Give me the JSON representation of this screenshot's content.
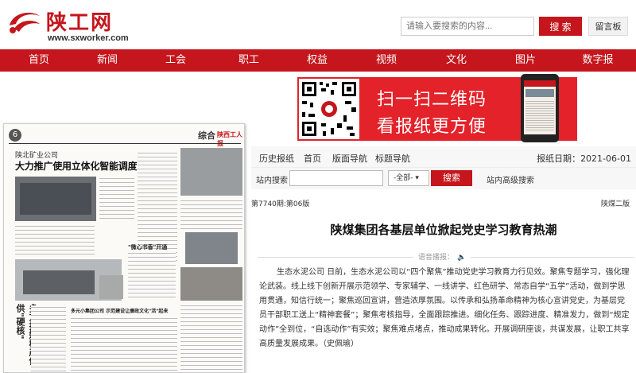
{
  "site": {
    "name": "陕工网",
    "domain": "www.sxworker.com"
  },
  "search": {
    "placeholder": "请输入要搜索的内容...",
    "button": "搜 索",
    "guestbook": "留言板"
  },
  "nav": [
    "首页",
    "新闻",
    "工会",
    "职工",
    "权益",
    "视频",
    "文化",
    "图片",
    "数字报"
  ],
  "banner": {
    "line1": "扫一扫二维码",
    "line2": "看报纸更方便"
  },
  "paper_thumb": {
    "page_number": "6",
    "section": "综合",
    "section_brand": "陕西工人报",
    "kicker": "陕北矿业公司",
    "headline": "大力推广使用立体化智能调度系统",
    "sub1": "\"微心书香\"开通",
    "sub2": "多方打好稳产保供\"硬核\"",
    "sub3": "多元小集团公司 示范建设让廉政文化\"活\"起来"
  },
  "tools": {
    "links": [
      "历史报纸",
      "首页",
      "版面导航",
      "标题导航"
    ],
    "date_label": "报纸日期：",
    "date": "2021-06-01"
  },
  "site_search": {
    "label": "站内搜索",
    "select": "-全部-",
    "button": "搜索",
    "advanced": "站内高级搜索"
  },
  "article": {
    "issue": "第7740期:第06版",
    "edition": "陕煤二版",
    "title": "陕煤集团各基层单位掀起党史学习教育热潮",
    "listen_label": "语音播报：",
    "body": "生态水泥公司 日前，生态水泥公司以“四个聚焦”推动党史学习教育力行见效。聚焦专题学习，强化理论武装。线上线下创新开展示范领学、专家辅学、一线讲学、红色研学、常态自学“五学”活动，做到学思用贯通，知信行统一；聚焦巡回宣讲，营造浓厚氛围。以传承和弘扬革命精神为核心宣讲党史，为基层党员干部职工送上“精神套餐”；聚焦考核指导，全面跟踪推进。细化任务、跟踪进度、精准发力，做到“规定动作”全到位，“自选动作”有实效；聚焦难点堵点，推动成果转化。开展调研座谈，共谋发展，让职工共享高质量发展成果。（史佩瑜）"
  },
  "colors": {
    "brand_red": "#c4161c",
    "banner_red": "#e3222a"
  }
}
